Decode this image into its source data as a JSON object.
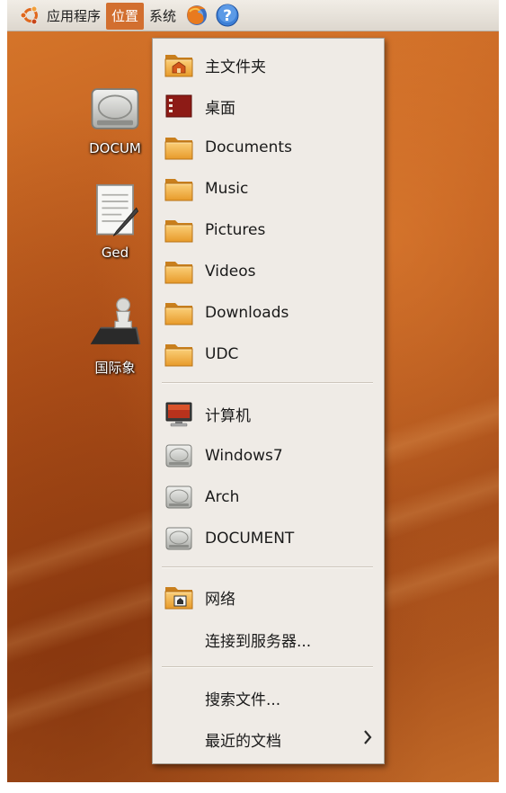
{
  "panel": {
    "menus": [
      {
        "label": "应用程序"
      },
      {
        "label": "位置"
      },
      {
        "label": "系统"
      }
    ],
    "launchers": [
      {
        "icon": "firefox-icon"
      },
      {
        "icon": "help-icon"
      }
    ]
  },
  "desktop": {
    "icons": [
      {
        "label": "DOCUM",
        "icon": "drive-icon"
      },
      {
        "label": "Ged",
        "icon": "text-editor-icon"
      },
      {
        "label": "国际象",
        "icon": "chess-icon"
      }
    ]
  },
  "places_menu": {
    "bookmarks": [
      {
        "label": "主文件夹",
        "icon": "home-folder-icon"
      },
      {
        "label": "桌面",
        "icon": "desktop-icon"
      },
      {
        "label": "Documents",
        "icon": "folder-icon"
      },
      {
        "label": "Music",
        "icon": "folder-icon"
      },
      {
        "label": "Pictures",
        "icon": "folder-icon"
      },
      {
        "label": "Videos",
        "icon": "folder-icon"
      },
      {
        "label": "Downloads",
        "icon": "folder-icon"
      },
      {
        "label": "UDC",
        "icon": "folder-icon"
      }
    ],
    "devices": [
      {
        "label": "计算机",
        "icon": "computer-icon"
      },
      {
        "label": "Windows7",
        "icon": "drive-icon"
      },
      {
        "label": "Arch",
        "icon": "drive-icon"
      },
      {
        "label": "DOCUMENT",
        "icon": "drive-icon"
      }
    ],
    "network": [
      {
        "label": "网络",
        "icon": "network-folder-icon"
      },
      {
        "label": "连接到服务器..."
      }
    ],
    "other": [
      {
        "label": "搜索文件..."
      },
      {
        "label": "最近的文档",
        "submenu_icon": "chevron-right-icon"
      }
    ]
  }
}
